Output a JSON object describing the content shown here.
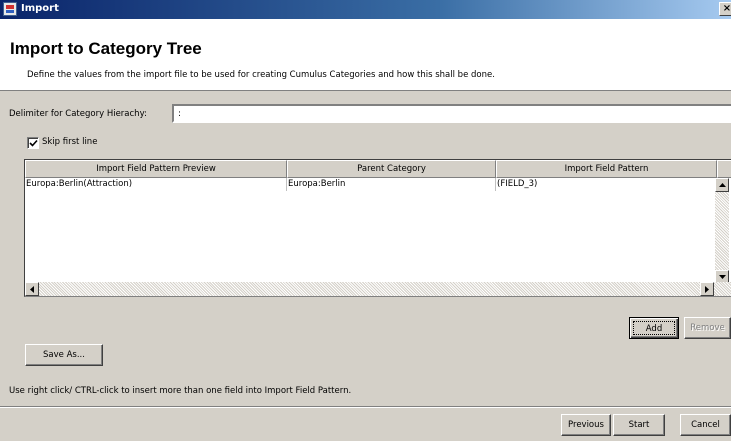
{
  "window": {
    "title": "Import"
  },
  "header": {
    "heading": "Import to Category Tree",
    "description": "Define the values from the import file to be used for creating Cumulus Categories and how this shall be done."
  },
  "delimiter": {
    "label": "Delimiter for Category Hierachy:",
    "value": ":"
  },
  "skip_first_line": {
    "label": "Skip first line",
    "checked": true
  },
  "table": {
    "columns": [
      "Import Field Pattern Preview",
      "Parent Category",
      "Import Field Pattern"
    ],
    "rows": [
      [
        "Europa:Berlin(Attraction)",
        "Europa:Berlin",
        "(FIELD_3)"
      ]
    ]
  },
  "buttons": {
    "add": "Add",
    "remove": "Remove",
    "save_as": "Save As...",
    "previous": "Previous",
    "start": "Start",
    "cancel": "Cancel"
  },
  "hint": "Use right click/ CTRL-click to insert more than one field into Import Field Pattern.",
  "icons": {
    "app": "app-icon",
    "close": "close-icon",
    "checkmark": "checkmark-icon",
    "scroll_up": "arrow-up-icon",
    "scroll_down": "arrow-down-icon",
    "scroll_left": "arrow-left-icon",
    "scroll_right": "arrow-right-icon"
  },
  "colors": {
    "titlebar_start": "#0a246a",
    "titlebar_end": "#a6caf0",
    "window_bg": "#d4d0c8"
  }
}
